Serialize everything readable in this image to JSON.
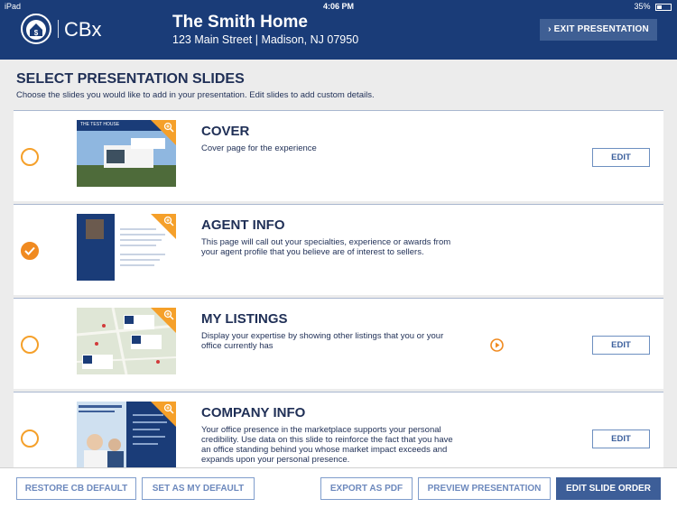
{
  "status_bar": {
    "carrier": "iPad",
    "time": "4:06 PM",
    "battery": "35%"
  },
  "header": {
    "brand": "CBx",
    "home_title": "The Smith Home",
    "home_address": "123 Main Street | Madison, NJ 07950",
    "exit_label": "EXIT PRESENTATION"
  },
  "section": {
    "title": "SELECT PRESENTATION SLIDES",
    "subtitle": "Choose the slides you would like to add in your presentation. Edit slides to add custom details."
  },
  "slides": [
    {
      "title": "COVER",
      "description": "Cover page for the experience",
      "selected": false,
      "edit_label": "EDIT",
      "thumb_caption": "THE TEST HOUSE"
    },
    {
      "title": "AGENT INFO",
      "description": "This page will call out your specialties, experience or awards from your agent profile that you believe are of interest to sellers.",
      "selected": true,
      "edit_label": ""
    },
    {
      "title": "MY LISTINGS",
      "description": "Display your expertise by showing other listings that you or your office currently has",
      "selected": false,
      "edit_label": "EDIT"
    },
    {
      "title": "COMPANY INFO",
      "description": "Your office presence in the marketplace supports your personal credibility. Use data on this slide to reinforce the fact that you have an office standing behind you whose market impact exceeds and expands upon your personal presence.",
      "selected": false,
      "edit_label": "EDIT"
    }
  ],
  "footer": {
    "restore_label": "RESTORE CB DEFAULT",
    "set_default_label": "SET AS MY DEFAULT",
    "export_label": "EXPORT AS PDF",
    "preview_label": "PREVIEW PRESENTATION",
    "edit_order_label": "EDIT SLIDE ORDER"
  },
  "colors": {
    "navy": "#1a3c78",
    "accent_orange": "#f5a02a",
    "button_blue": "#3d5e98"
  }
}
